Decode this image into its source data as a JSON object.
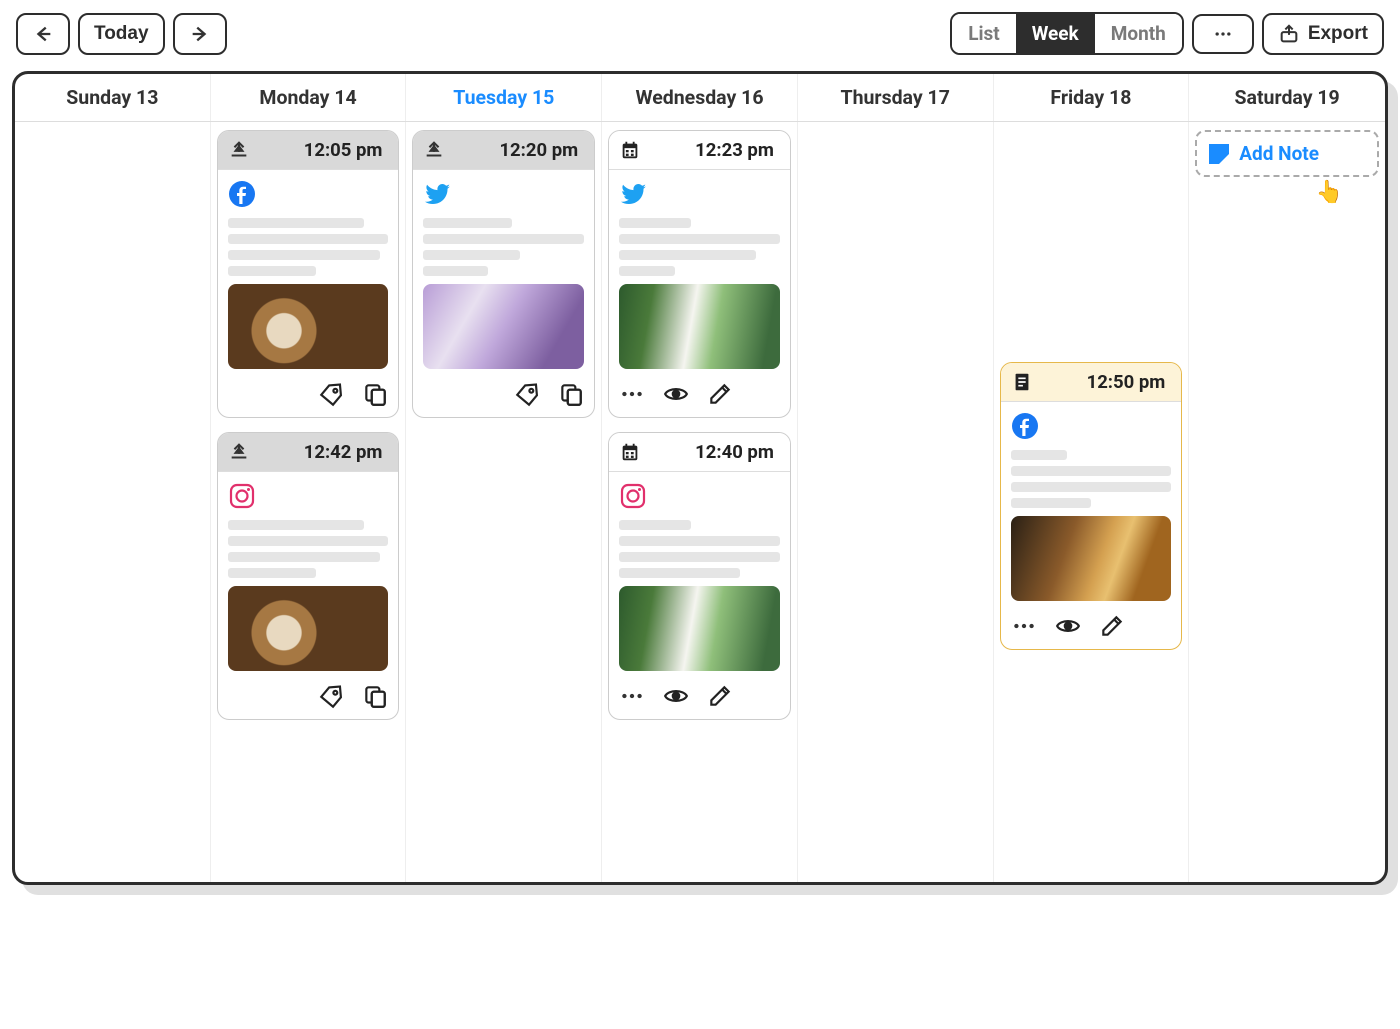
{
  "toolbar": {
    "today_label": "Today",
    "views": {
      "list": "List",
      "week": "Week",
      "month": "Month"
    },
    "active_view": "Week",
    "export_label": "Export"
  },
  "days": [
    {
      "label": "Sunday 13",
      "today": false
    },
    {
      "label": "Monday 14",
      "today": false
    },
    {
      "label": "Tuesday 15",
      "today": true
    },
    {
      "label": "Wednesday 16",
      "today": false
    },
    {
      "label": "Thursday 17",
      "today": false
    },
    {
      "label": "Friday 18",
      "today": false
    },
    {
      "label": "Saturday 19",
      "today": false
    }
  ],
  "add_note_label": "Add Note",
  "posts": {
    "mon1": {
      "status": "published",
      "icon": "upload",
      "time": "12:05 pm",
      "network": "facebook",
      "thumb": "coffee",
      "actions": [
        "tag",
        "copy"
      ]
    },
    "mon2": {
      "status": "published",
      "icon": "upload",
      "time": "12:42 pm",
      "network": "instagram",
      "thumb": "coffee",
      "actions": [
        "tag",
        "copy"
      ]
    },
    "tue1": {
      "status": "published",
      "icon": "upload",
      "time": "12:20 pm",
      "network": "twitter",
      "thumb": "lilac",
      "actions": [
        "tag",
        "copy"
      ]
    },
    "wed1": {
      "status": "scheduled",
      "icon": "calendar",
      "time": "12:23 pm",
      "network": "twitter",
      "thumb": "matcha",
      "actions": [
        "more",
        "eye",
        "edit"
      ]
    },
    "wed2": {
      "status": "scheduled",
      "icon": "calendar",
      "time": "12:40 pm",
      "network": "instagram",
      "thumb": "matcha",
      "actions": [
        "more",
        "eye",
        "edit"
      ]
    },
    "fri1": {
      "status": "note",
      "icon": "note",
      "time": "12:50 pm",
      "network": "facebook",
      "thumb": "whiskey",
      "actions": [
        "more",
        "eye",
        "edit"
      ]
    }
  }
}
